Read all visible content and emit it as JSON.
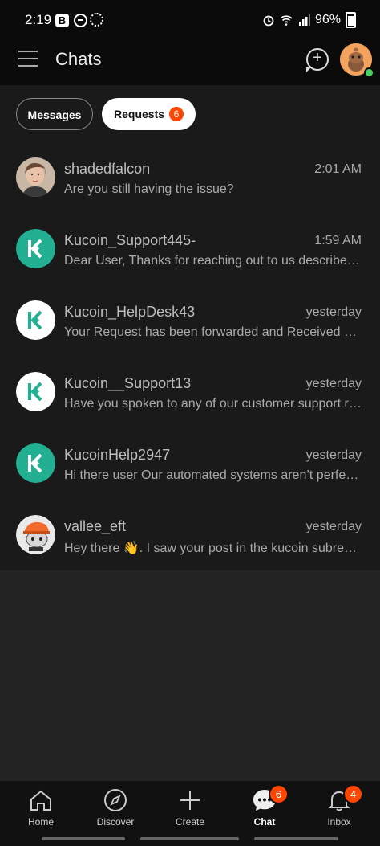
{
  "status": {
    "time": "2:19",
    "b_icon": "B",
    "battery": "96%"
  },
  "header": {
    "title": "Chats"
  },
  "filters": {
    "messages": "Messages",
    "requests": "Requests",
    "requests_count": "6"
  },
  "chats": [
    {
      "name": "shadedfalcon",
      "time": "2:01 AM",
      "message": "Are you still having the issue?",
      "avatar": "person-photo"
    },
    {
      "name": "Kucoin_Support445-",
      "time": "1:59 AM",
      "message": "Dear User, Thanks for reaching out to us describe y...",
      "avatar": "kucoin-logo-green"
    },
    {
      "name": "Kucoin_HelpDesk43",
      "time": "yesterday",
      "message": "Your Request has been forwarded and Received Su...",
      "avatar": "kucoin-logo-white"
    },
    {
      "name": "Kucoin__Support13",
      "time": "yesterday",
      "message": "Have you spoken to any of our customer support re...",
      "avatar": "kucoin-logo-white"
    },
    {
      "name": "KucoinHelp2947",
      "time": "yesterday",
      "message": "Hi there user Our automated systems aren’t perfect...",
      "avatar": "kucoin-logo-green"
    },
    {
      "name": "vallee_eft",
      "time": "yesterday",
      "message": "Hey there 👋. I saw your post in the kucoin subredd...",
      "avatar": "snoo-avatar"
    }
  ],
  "nav": {
    "home": "Home",
    "discover": "Discover",
    "create": "Create",
    "chat": "Chat",
    "chat_badge": "6",
    "inbox": "Inbox",
    "inbox_badge": "4"
  },
  "colors": {
    "accent": "#ff4500",
    "kucoin_green": "#23af91",
    "online": "#46d160"
  }
}
